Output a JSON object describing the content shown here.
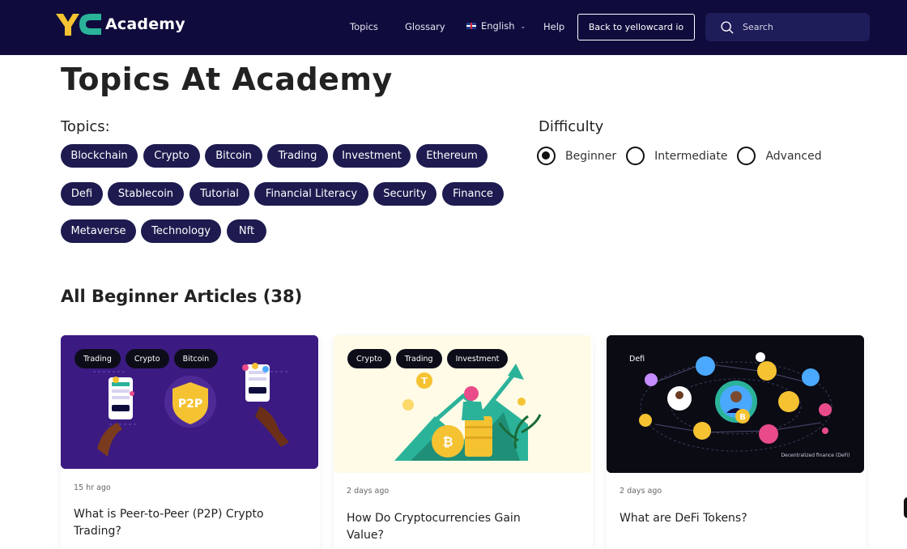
{
  "header": {
    "logo_text": "Academy",
    "nav": {
      "topics": "Topics",
      "glossary": "Glossary",
      "language": "English",
      "help": "Help"
    },
    "back_button": "Back to yellowcard io",
    "search_placeholder": "Search"
  },
  "page_title": "Topics At Academy",
  "topics": {
    "label": "Topics:",
    "items": [
      "Blockchain",
      "Crypto",
      "Bitcoin",
      "Trading",
      "Investment",
      "Ethereum",
      "Defi",
      "Stablecoin",
      "Tutorial",
      "Financial Literacy",
      "Security",
      "Finance",
      "Metaverse",
      "Technology",
      "Nft"
    ]
  },
  "difficulty": {
    "label": "Difficulty",
    "options": [
      "Beginner",
      "Intermediate",
      "Advanced"
    ],
    "selected": "Beginner"
  },
  "articles_heading": "All Beginner Articles (38)",
  "articles": [
    {
      "tags": [
        "Trading",
        "Crypto",
        "Bitcoin"
      ],
      "image_badge": "P2P",
      "time": "15 hr ago",
      "title": "What is Peer-to-Peer (P2P) Crypto Trading?"
    },
    {
      "tags": [
        "Crypto",
        "Trading",
        "Investment"
      ],
      "time": "2 days ago",
      "title": "How Do Cryptocurrencies Gain Value?"
    },
    {
      "tags": [
        "Defi"
      ],
      "image_caption": "Decentralized finance (DeFi)",
      "time": "2 days ago",
      "title": "What are DeFi Tokens?"
    }
  ],
  "colors": {
    "header_bg": "#0f0c3d",
    "chip_bg": "#1d1b4f",
    "accent_yellow": "#f5c232",
    "accent_green": "#2bb39a"
  }
}
